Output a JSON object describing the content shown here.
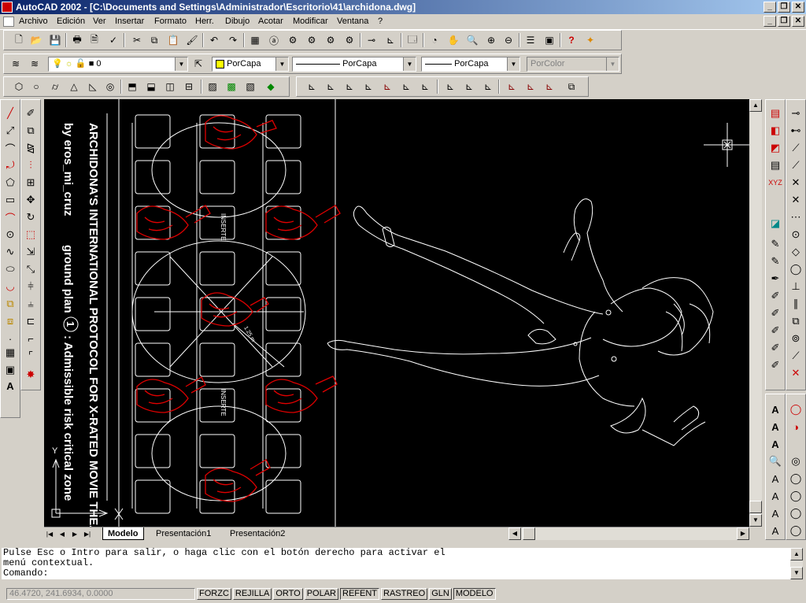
{
  "window": {
    "title": "AutoCAD 2002 - [C:\\Documents and Settings\\Administrador\\Escritorio\\41\\archidona.dwg]"
  },
  "menu": [
    "Archivo",
    "Edición",
    "Ver",
    "Insertar",
    "Formato",
    "Herr.",
    "Dibujo",
    "Acotar",
    "Modificar",
    "Ventana",
    "?"
  ],
  "layers": {
    "current": "0",
    "color": "PorCapa",
    "linetype": "PorCapa",
    "lineweight": "PorCapa",
    "plotstyle": "PorColor"
  },
  "drawing": {
    "title": "ARCHIDONA'S INTERNATIONAL PROTOCOL FOR X-RATED MOVIE THEATERS",
    "subtitle_by": "by eros_mi_cruz",
    "subtitle_plan": "ground plan",
    "plan_number": "1",
    "subtitle_rest": ": Admissible risk critical zone",
    "label_inserte": "INSERTE",
    "dimension": "1.25 m",
    "ucs_y": "Y"
  },
  "tabs": [
    "Modelo",
    "Presentación1",
    "Presentación2"
  ],
  "command": {
    "line1": "Pulse Esc o Intro para salir, o haga clic con el botón derecho para activar el",
    "line2": "menú contextual.",
    "prompt": "Comando:"
  },
  "status": {
    "coords": "46.4720, 241.6934, 0.0000",
    "buttons": [
      "FORZC",
      "REJILLA",
      "ORTO",
      "POLAR",
      "REFENT",
      "RASTREO",
      "GLN",
      "MODELO"
    ]
  },
  "colors": {
    "canvas": "#000000",
    "accent_red": "#e00000",
    "lines": "#ffffff"
  }
}
